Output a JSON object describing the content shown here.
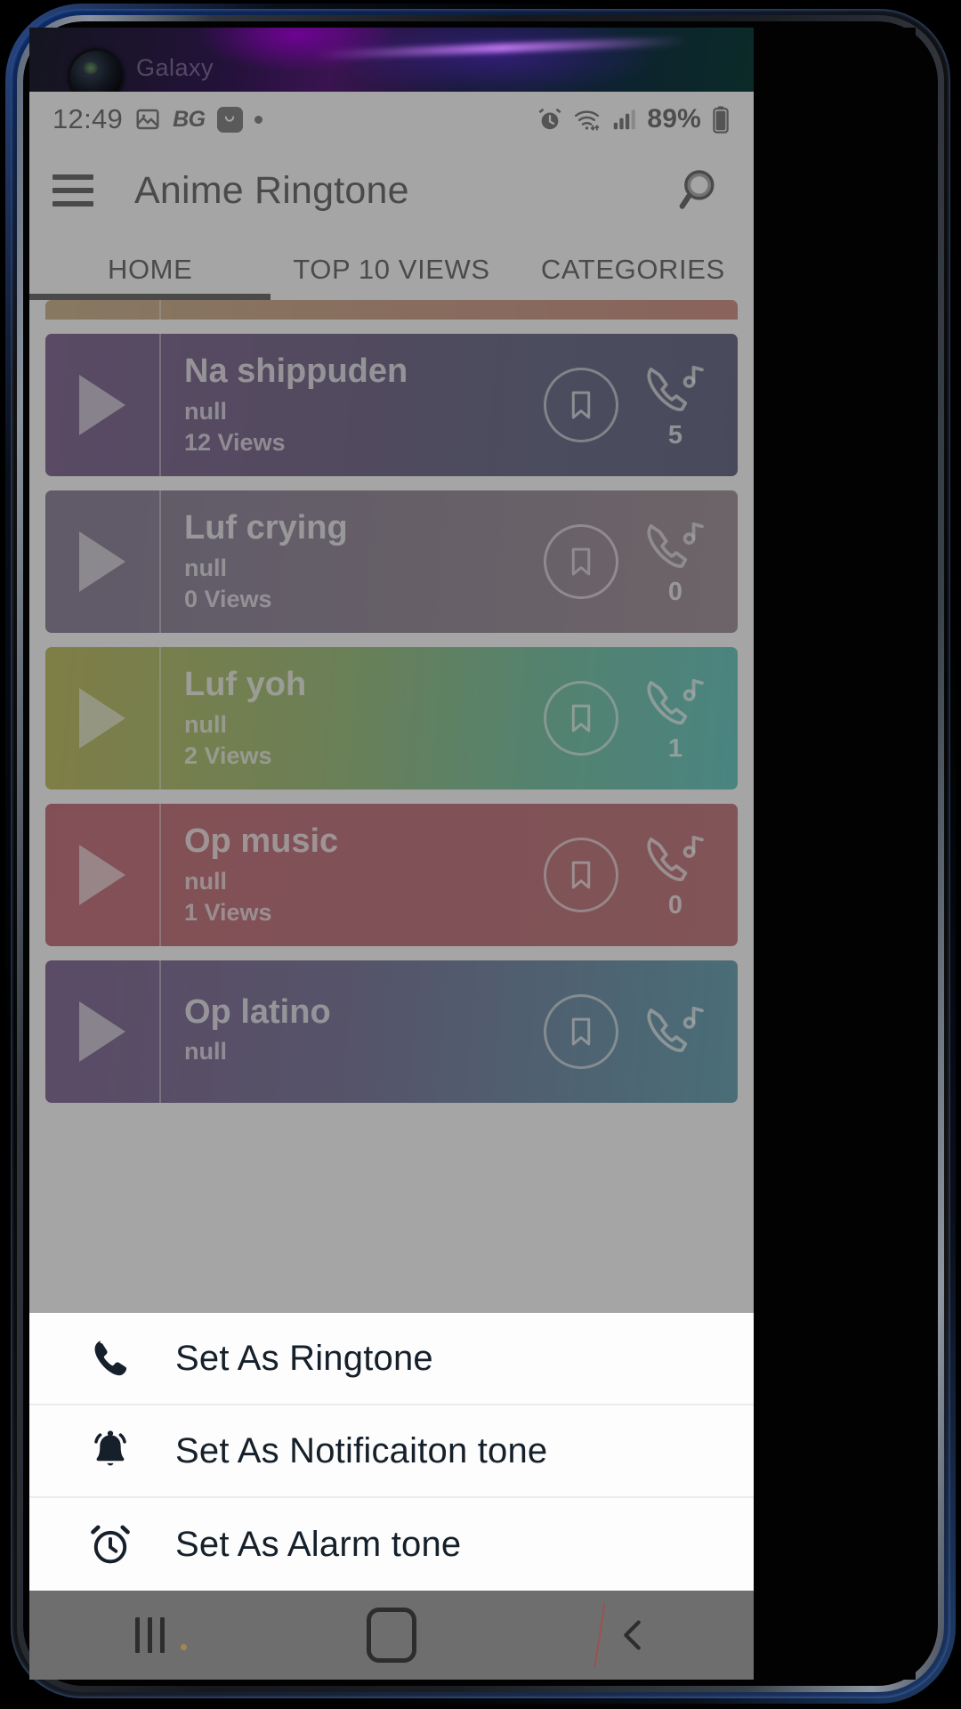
{
  "wallpaper": {
    "label": "Galaxy"
  },
  "status_bar": {
    "time": "12:49",
    "battery_percent": "89%",
    "icons_left": [
      "image-icon",
      "bg-badge-icon",
      "smiley-badge-icon",
      "dot-badge-icon"
    ],
    "bg_badge": "BG",
    "icons_right": [
      "alarm-icon",
      "wifi-icon",
      "signal-icon",
      "battery-icon"
    ]
  },
  "app_bar": {
    "menu_icon": "hamburger-icon",
    "title": "Anime Ringtone",
    "search_icon": "search-icon"
  },
  "tabs": [
    {
      "label": "HOME",
      "active": true
    },
    {
      "label": "TOP 10 VIEWS",
      "active": false
    },
    {
      "label": "CATEGORIES",
      "active": false
    }
  ],
  "list": {
    "peek_top": {
      "gradient_from": "#b08a4e",
      "gradient_to": "#b5513f"
    },
    "items": [
      {
        "title": "Na shippuden",
        "subtitle": "null",
        "views": "12 Views",
        "ringtone_count": "5",
        "gradient_from": "#3b1057",
        "gradient_to": "#0d1240"
      },
      {
        "title": "Luf crying",
        "subtitle": "null",
        "views": "0 Views",
        "ringtone_count": "0",
        "gradient_from": "#4a3a63",
        "gradient_to": "#6c5560"
      },
      {
        "title": "Luf yoh",
        "subtitle": "null",
        "views": "2 Views",
        "ringtone_count": "1",
        "gradient_from": "#9c9a06",
        "gradient_to": "#11a9a0"
      },
      {
        "title": "Op music",
        "subtitle": "null",
        "views": "1 Views",
        "ringtone_count": "0",
        "gradient_from": "#a31f30",
        "gradient_to": "#a02a33"
      },
      {
        "title": "Op latino",
        "subtitle": "null",
        "views": "",
        "ringtone_count": "",
        "gradient_from": "#3d1258",
        "gradient_to": "#0f6f88"
      }
    ],
    "bookmark_icon": "bookmark-icon",
    "ringtone_icon": "phone-music-icon",
    "play_icon": "play-icon"
  },
  "bottom_sheet": {
    "items": [
      {
        "label": "Set As Ringtone",
        "icon": "phone-icon"
      },
      {
        "label": "Set As Notificaiton tone",
        "icon": "bell-icon"
      },
      {
        "label": "Set As Alarm tone",
        "icon": "alarm-clock-icon"
      }
    ]
  },
  "nav_bar": {
    "recents": "recents-icon",
    "home": "home-icon",
    "back": "back-icon"
  },
  "colors": {
    "scrim": "#6e6e6e",
    "sheet_bg": "#fdfdfd",
    "text_dark": "#15202b",
    "tab_indicator": "#111111"
  }
}
